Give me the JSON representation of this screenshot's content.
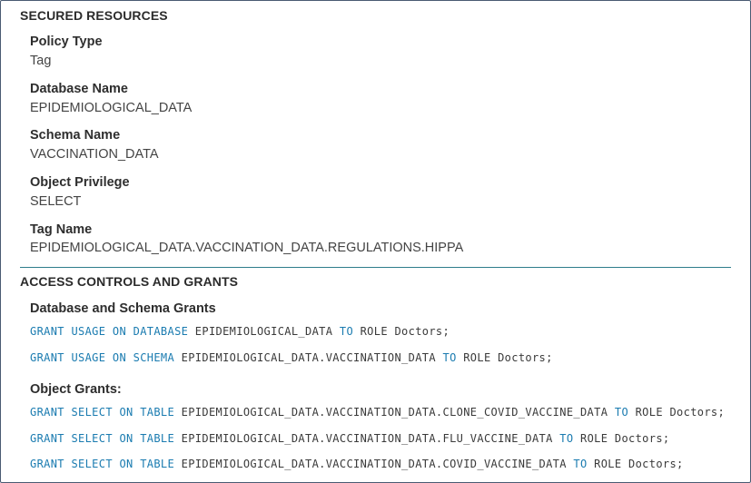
{
  "secured_resources": {
    "title": "SECURED RESOURCES",
    "fields": [
      {
        "label": "Policy Type",
        "value": "Tag"
      },
      {
        "label": "Database Name",
        "value": "EPIDEMIOLOGICAL_DATA"
      },
      {
        "label": "Schema Name",
        "value": "VACCINATION_DATA"
      },
      {
        "label": "Object Privilege",
        "value": "SELECT"
      },
      {
        "label": "Tag Name",
        "value": "EPIDEMIOLOGICAL_DATA.VACCINATION_DATA.REGULATIONS.HIPPA"
      }
    ]
  },
  "access_controls": {
    "title": "ACCESS CONTROLS AND GRANTS",
    "db_schema_heading": "Database and Schema Grants",
    "db_schema_grants": [
      {
        "kw1": "GRANT USAGE ON DATABASE",
        "obj": "EPIDEMIOLOGICAL_DATA",
        "kw2": "TO",
        "tail": "ROLE Doctors;"
      },
      {
        "kw1": "GRANT USAGE ON SCHEMA",
        "obj": "EPIDEMIOLOGICAL_DATA.VACCINATION_DATA",
        "kw2": "TO",
        "tail": "ROLE Doctors;"
      }
    ],
    "object_heading": "Object Grants:",
    "object_grants": [
      {
        "kw1": "GRANT SELECT ON TABLE",
        "obj": "EPIDEMIOLOGICAL_DATA.VACCINATION_DATA.CLONE_COVID_VACCINE_DATA",
        "kw2": "TO",
        "tail": "ROLE Doctors;"
      },
      {
        "kw1": "GRANT SELECT ON TABLE",
        "obj": "EPIDEMIOLOGICAL_DATA.VACCINATION_DATA.FLU_VACCINE_DATA",
        "kw2": "TO",
        "tail": "ROLE Doctors;"
      },
      {
        "kw1": "GRANT SELECT ON TABLE",
        "obj": "EPIDEMIOLOGICAL_DATA.VACCINATION_DATA.COVID_VACCINE_DATA",
        "kw2": "TO",
        "tail": "ROLE Doctors;"
      }
    ]
  },
  "colors": {
    "keyword": "#1a7bb0",
    "divider": "#2e7d8c",
    "frame_border": "#4a5a72"
  }
}
